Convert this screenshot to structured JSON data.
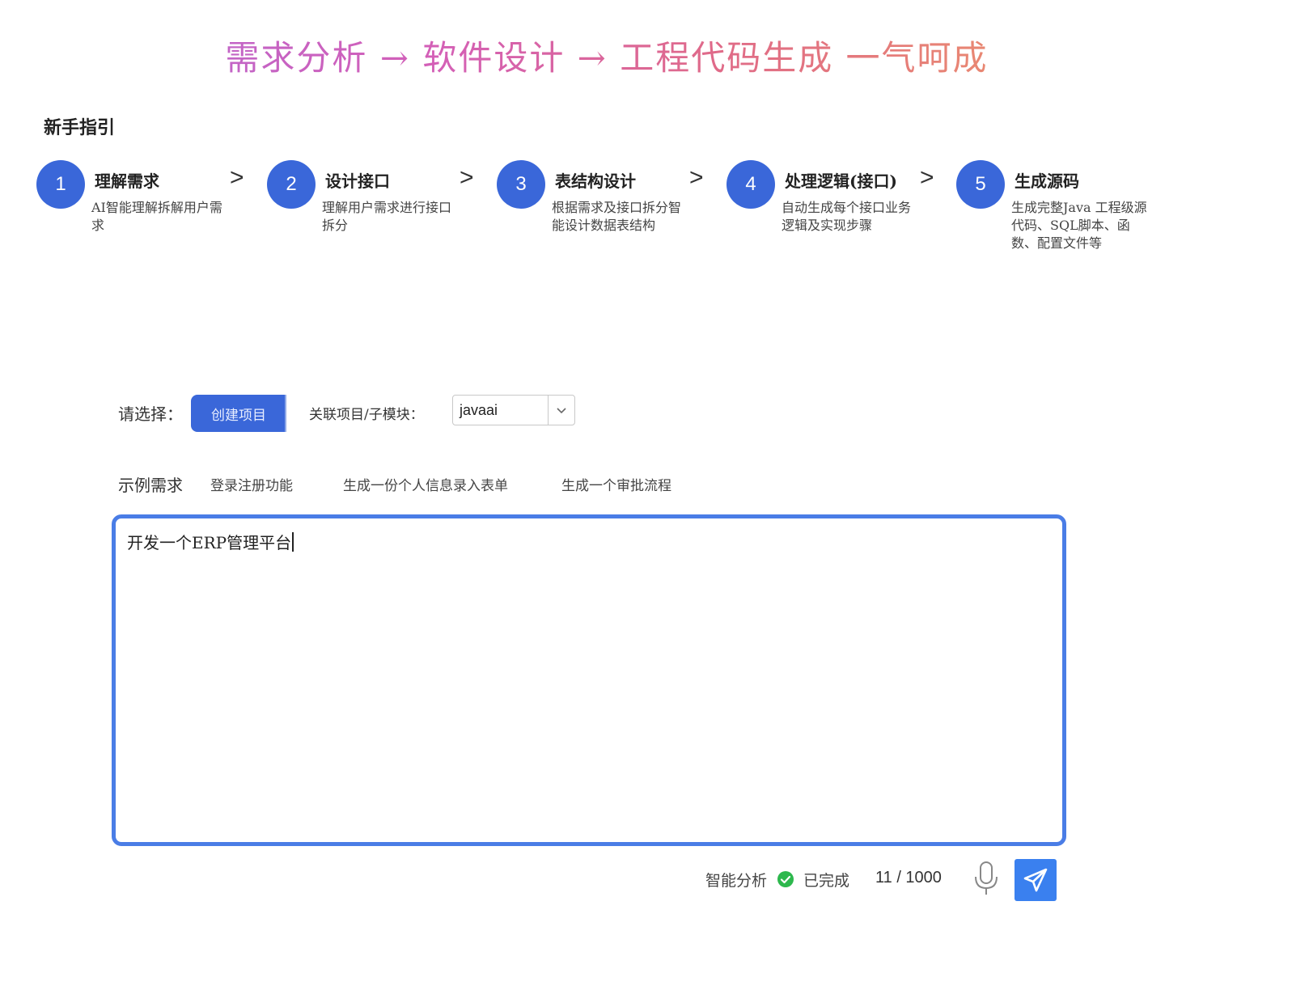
{
  "hero": {
    "title": "需求分析 → 软件设计 → 工程代码生成 一气呵成"
  },
  "guide": {
    "title": "新手指引",
    "separator": ">",
    "steps": [
      {
        "num": "1",
        "title": "理解需求",
        "desc": "AI智能理解拆解用户需求"
      },
      {
        "num": "2",
        "title": "设计接口",
        "desc": "理解用户需求进行接口拆分"
      },
      {
        "num": "3",
        "title": "表结构设计",
        "desc": "根据需求及接口拆分智能设计数据表结构"
      },
      {
        "num": "4",
        "title": "处理逻辑(接口)",
        "desc": "自动生成每个接口业务逻辑及实现步骤"
      },
      {
        "num": "5",
        "title": "生成源码",
        "desc": "生成完整Java 工程级源代码、SQL脚本、函数、配置文件等"
      }
    ]
  },
  "select_row": {
    "label": "请选择：",
    "create_button": "创建项目",
    "link_label": "关联项目/子模块：",
    "project_value": "javaai"
  },
  "examples": {
    "label": "示例需求",
    "items": [
      "登录注册功能",
      "生成一份个人信息录入表单",
      "生成一个审批流程"
    ]
  },
  "input": {
    "value": "开发一个ERP管理平台"
  },
  "footer": {
    "smart_label": "智能分析",
    "status": "已完成",
    "counter": "11 / 1000"
  },
  "colors": {
    "accent": "#3a67d9",
    "input_border": "#4a7de6",
    "send_button": "#3a80ef",
    "success": "#2db84d"
  },
  "icons": {
    "status": "check-circle-icon",
    "voice": "microphone-icon",
    "send": "send-icon",
    "dropdown": "chevron-down-icon"
  }
}
